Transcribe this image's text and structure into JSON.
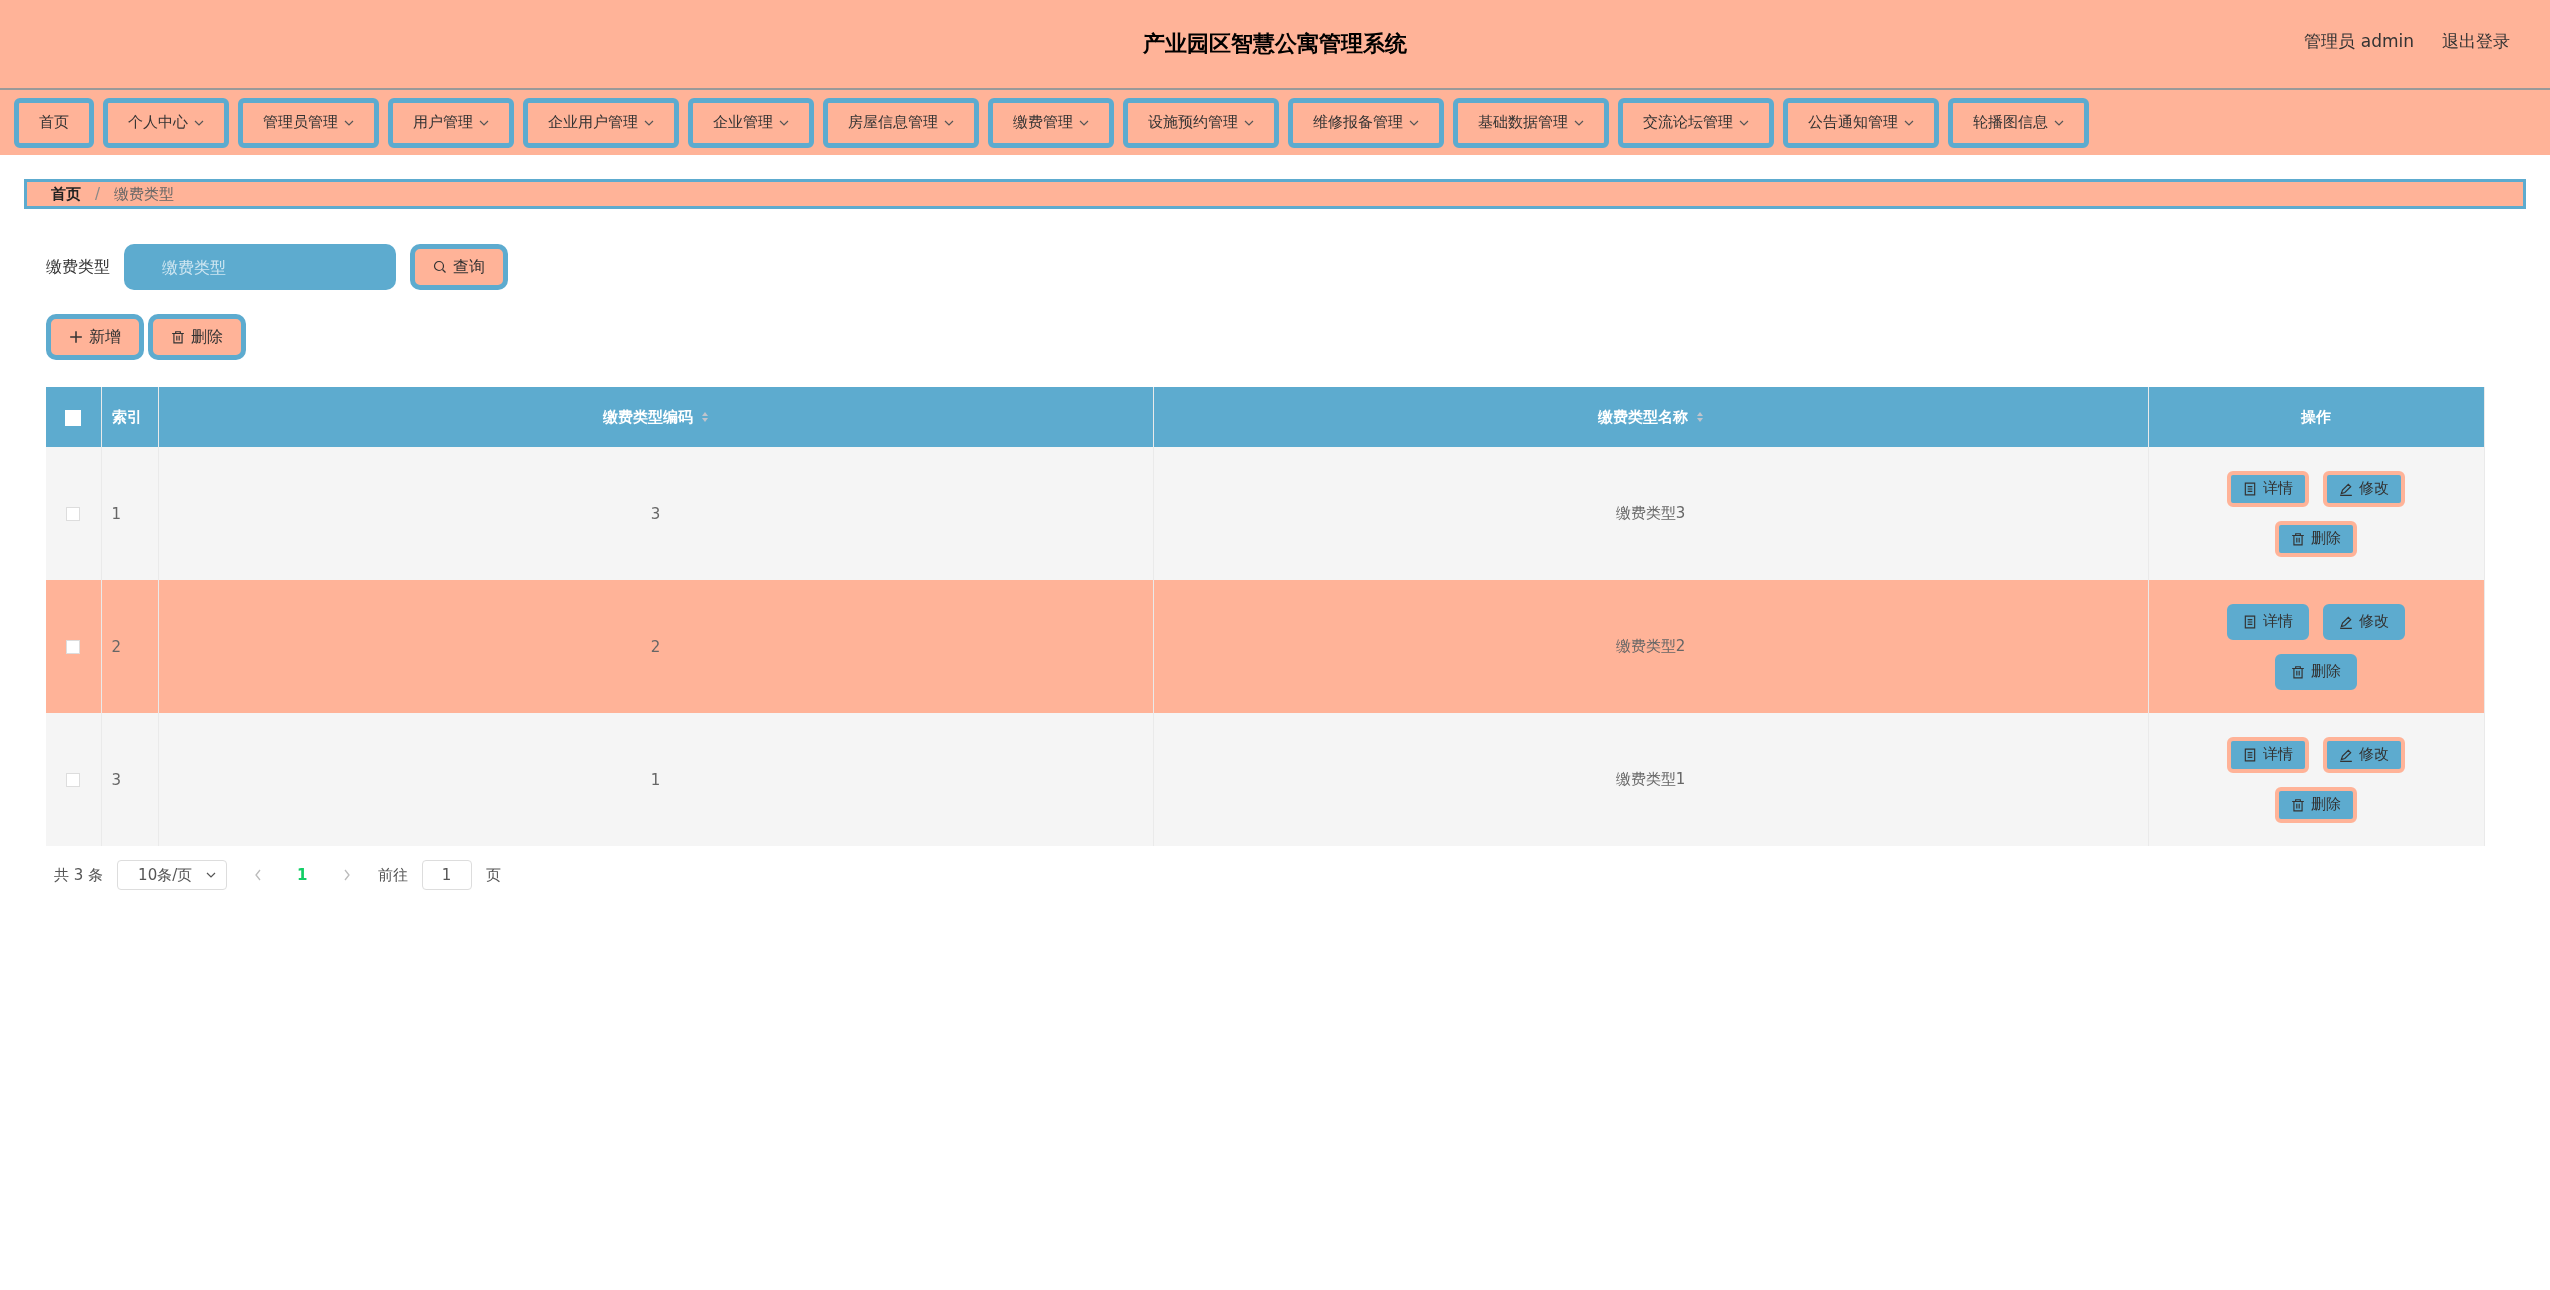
{
  "header": {
    "title": "产业园区智慧公寓管理系统",
    "user": "管理员 admin",
    "logout": "退出登录"
  },
  "nav": [
    {
      "label": "首页",
      "dropdown": false
    },
    {
      "label": "个人中心",
      "dropdown": true
    },
    {
      "label": "管理员管理",
      "dropdown": true
    },
    {
      "label": "用户管理",
      "dropdown": true
    },
    {
      "label": "企业用户管理",
      "dropdown": true
    },
    {
      "label": "企业管理",
      "dropdown": true
    },
    {
      "label": "房屋信息管理",
      "dropdown": true
    },
    {
      "label": "缴费管理",
      "dropdown": true
    },
    {
      "label": "设施预约管理",
      "dropdown": true
    },
    {
      "label": "维修报备管理",
      "dropdown": true
    },
    {
      "label": "基础数据管理",
      "dropdown": true
    },
    {
      "label": "交流论坛管理",
      "dropdown": true
    },
    {
      "label": "公告通知管理",
      "dropdown": true
    },
    {
      "label": "轮播图信息",
      "dropdown": true
    }
  ],
  "breadcrumb": [
    "首页",
    "缴费类型"
  ],
  "breadcrumb_separator": "/",
  "search": {
    "label": "缴费类型",
    "placeholder": "缴费类型",
    "button": "查询"
  },
  "actions": [
    {
      "kind": "add",
      "label": "新增"
    },
    {
      "kind": "delete",
      "label": "删除"
    }
  ],
  "table": {
    "columns": [
      {
        "label": "索引",
        "sortable": false
      },
      {
        "label": "缴费类型编码",
        "sortable": true
      },
      {
        "label": "缴费类型名称",
        "sortable": true
      },
      {
        "label": "操作",
        "sortable": false
      }
    ],
    "header_checked": false,
    "rows": [
      {
        "index": "1",
        "code": "3",
        "name": "缴费类型3",
        "checked": false,
        "highlighted": false,
        "buttons": [
          {
            "kind": "detail",
            "label": "详情"
          },
          {
            "kind": "edit",
            "label": "修改"
          },
          {
            "kind": "delete",
            "label": "删除"
          }
        ]
      },
      {
        "index": "2",
        "code": "2",
        "name": "缴费类型2",
        "checked": false,
        "highlighted": true,
        "buttons": [
          {
            "kind": "detail",
            "label": "详情"
          },
          {
            "kind": "edit",
            "label": "修改"
          },
          {
            "kind": "delete",
            "label": "删除"
          }
        ]
      },
      {
        "index": "3",
        "code": "1",
        "name": "缴费类型1",
        "checked": false,
        "highlighted": false,
        "buttons": [
          {
            "kind": "detail",
            "label": "详情"
          },
          {
            "kind": "edit",
            "label": "修改"
          },
          {
            "kind": "delete",
            "label": "删除"
          }
        ]
      }
    ]
  },
  "pagination": {
    "total": "共 3 条",
    "page_size": "10条/页",
    "pages": [
      {
        "label": "1",
        "selected": true
      }
    ],
    "goto_label": "前往",
    "goto_value": "1",
    "page_suffix": "页"
  }
}
